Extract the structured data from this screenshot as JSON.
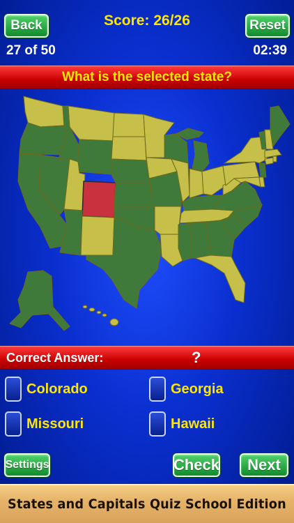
{
  "header": {
    "back_label": "Back",
    "reset_label": "Reset",
    "score": "Score: 26/26",
    "progress": "27 of 50",
    "timer": "02:39"
  },
  "question": "What is the selected state?",
  "answer": {
    "label": "Correct Answer:",
    "value": "?"
  },
  "options": [
    {
      "label": "Colorado"
    },
    {
      "label": "Georgia"
    },
    {
      "label": "Missouri"
    },
    {
      "label": "Hawaii"
    }
  ],
  "footer": {
    "settings_label": "Settings",
    "check_label": "Check",
    "next_label": "Next",
    "banner": "States and Capitals Quiz School Edition"
  },
  "colors": {
    "answered_state": "#3f7a3a",
    "unanswered_state": "#c6bf4a",
    "selected_state": "#c9313f",
    "accent_text": "#ffe600"
  }
}
